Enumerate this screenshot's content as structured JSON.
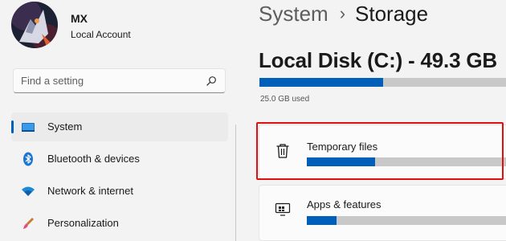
{
  "account": {
    "name": "MX",
    "type": "Local Account"
  },
  "search": {
    "placeholder": "Find a setting",
    "value": ""
  },
  "sidebar": {
    "items": [
      {
        "label": "System",
        "icon": "system-monitor-icon",
        "active": true
      },
      {
        "label": "Bluetooth & devices",
        "icon": "bluetooth-icon",
        "active": false
      },
      {
        "label": "Network & internet",
        "icon": "wifi-icon",
        "active": false
      },
      {
        "label": "Personalization",
        "icon": "paintbrush-icon",
        "active": false
      }
    ]
  },
  "breadcrumb": {
    "parent": "System",
    "separator": "›",
    "current": "Storage"
  },
  "disk": {
    "title": "Local Disk (C:) - 49.3 GB",
    "used_text": "25.0 GB used",
    "used_fraction": 0.5
  },
  "categories": [
    {
      "label": "Temporary files",
      "icon": "trash-icon",
      "fraction": 0.34,
      "highlighted": true
    },
    {
      "label": "Apps & features",
      "icon": "apps-features-icon",
      "fraction": 0.15,
      "highlighted": false
    }
  ],
  "colors": {
    "accent": "#005fb8",
    "track": "#c8c8c8",
    "highlight": "#e01010"
  }
}
